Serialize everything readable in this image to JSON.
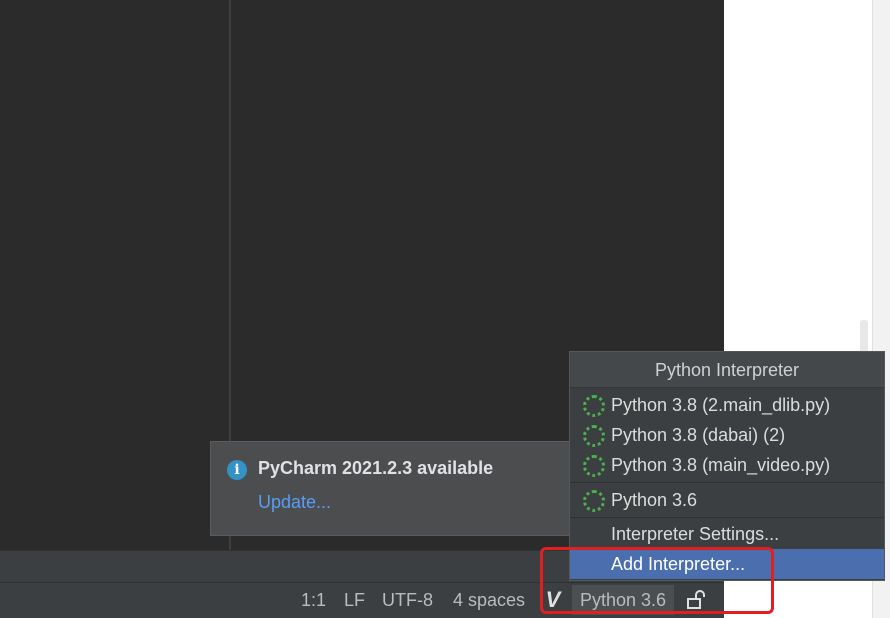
{
  "notification": {
    "title": "PyCharm 2021.2.3 available",
    "link": "Update..."
  },
  "interpreter_popup": {
    "header": "Python Interpreter",
    "interpreters": [
      {
        "label": "Python 3.8 (2.main_dlib.py)"
      },
      {
        "label": "Python 3.8 (dabai) (2)"
      },
      {
        "label": "Python 3.8 (main_video.py)"
      }
    ],
    "current": {
      "label": "Python 3.6"
    },
    "settings_label": "Interpreter Settings...",
    "add_label": "Add Interpreter..."
  },
  "status_bar": {
    "position": "1:1",
    "line_separator": "LF",
    "encoding": "UTF-8",
    "indent": "4 spaces",
    "interpreter": "Python 3.6"
  },
  "icons": {
    "info": "info-icon",
    "vim": "vim-icon",
    "lock": "unlocked-icon",
    "interpreter": "spinner-ring-icon"
  },
  "colors": {
    "editor_bg": "#2b2b2b",
    "panel_bg": "#3c3f41",
    "selection": "#4b6eaf",
    "link": "#589df6",
    "highlight": "#e02020",
    "ring": "#4caf50"
  }
}
